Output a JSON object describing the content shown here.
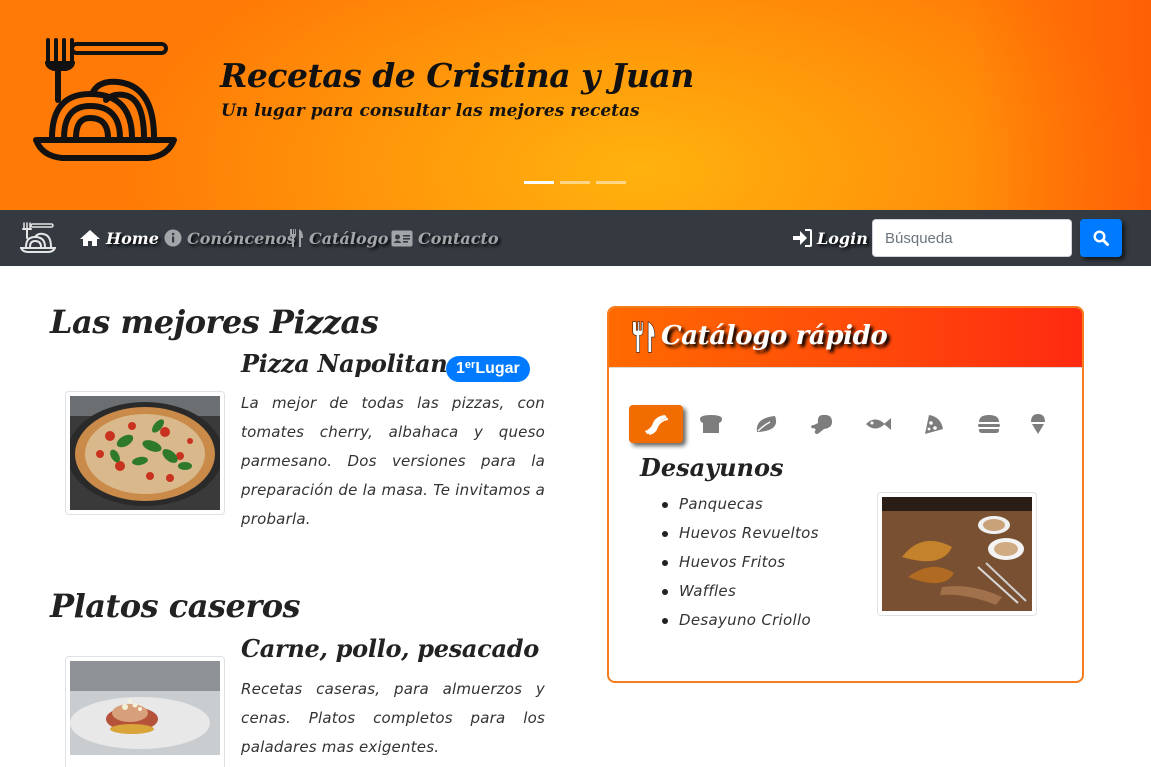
{
  "banner": {
    "title": "Recetas de Cristina y Juan",
    "subtitle": "Un lugar para consultar las mejores recetas",
    "logo_icon": "spaghetti-plate-icon",
    "carousel_slides": 3,
    "active_slide": 1
  },
  "navbar": {
    "logo_icon": "spaghetti-plate-icon",
    "items": [
      {
        "label": "Home",
        "icon": "home-icon"
      },
      {
        "label": "Conóncenos",
        "icon": "info-circle-icon"
      },
      {
        "label": "Catálogo",
        "icon": "utensils-icon"
      },
      {
        "label": "Contacto",
        "icon": "address-card-icon"
      }
    ],
    "login_label": "Login",
    "search_placeholder": "Búsqueda",
    "search_value": ""
  },
  "sections": [
    {
      "title": "Las mejores Pizzas",
      "item_title": "Pizza Napolitana",
      "badge_sup": "er",
      "badge_pre": "1",
      "badge_label": "Lugar",
      "text": "La mejor de todas las pizzas, con tomates cherry, albahaca y queso parmesano. Dos versiones para la preparación de la masa. Te invitamos a probarla."
    },
    {
      "title": "Platos caseros",
      "item_title": "Carne, pollo, pesacado",
      "text": "Recetas caseras, para almuerzos y cenas. Platos completos para los paladares mas exigentes."
    }
  ],
  "catalog": {
    "title": "Catálogo rápido",
    "tabs": [
      {
        "icon": "bacon-icon",
        "active": true
      },
      {
        "icon": "bread-slice-icon",
        "active": false
      },
      {
        "icon": "leaf-icon",
        "active": false
      },
      {
        "icon": "drumstick-icon",
        "active": false
      },
      {
        "icon": "fish-icon",
        "active": false
      },
      {
        "icon": "pizza-slice-icon",
        "active": false
      },
      {
        "icon": "hamburger-icon",
        "active": false
      },
      {
        "icon": "ice-cream-icon",
        "active": false
      }
    ],
    "heading": "Desayunos",
    "items": [
      "Panquecas",
      "Huevos Revueltos",
      "Huevos Fritos",
      "Waffles",
      "Desayuno Criollo"
    ]
  },
  "colors": {
    "accent_orange": "#f26d00",
    "navbar_bg": "#343a40",
    "primary_blue": "#007bff",
    "card_border": "#f57c1f"
  }
}
